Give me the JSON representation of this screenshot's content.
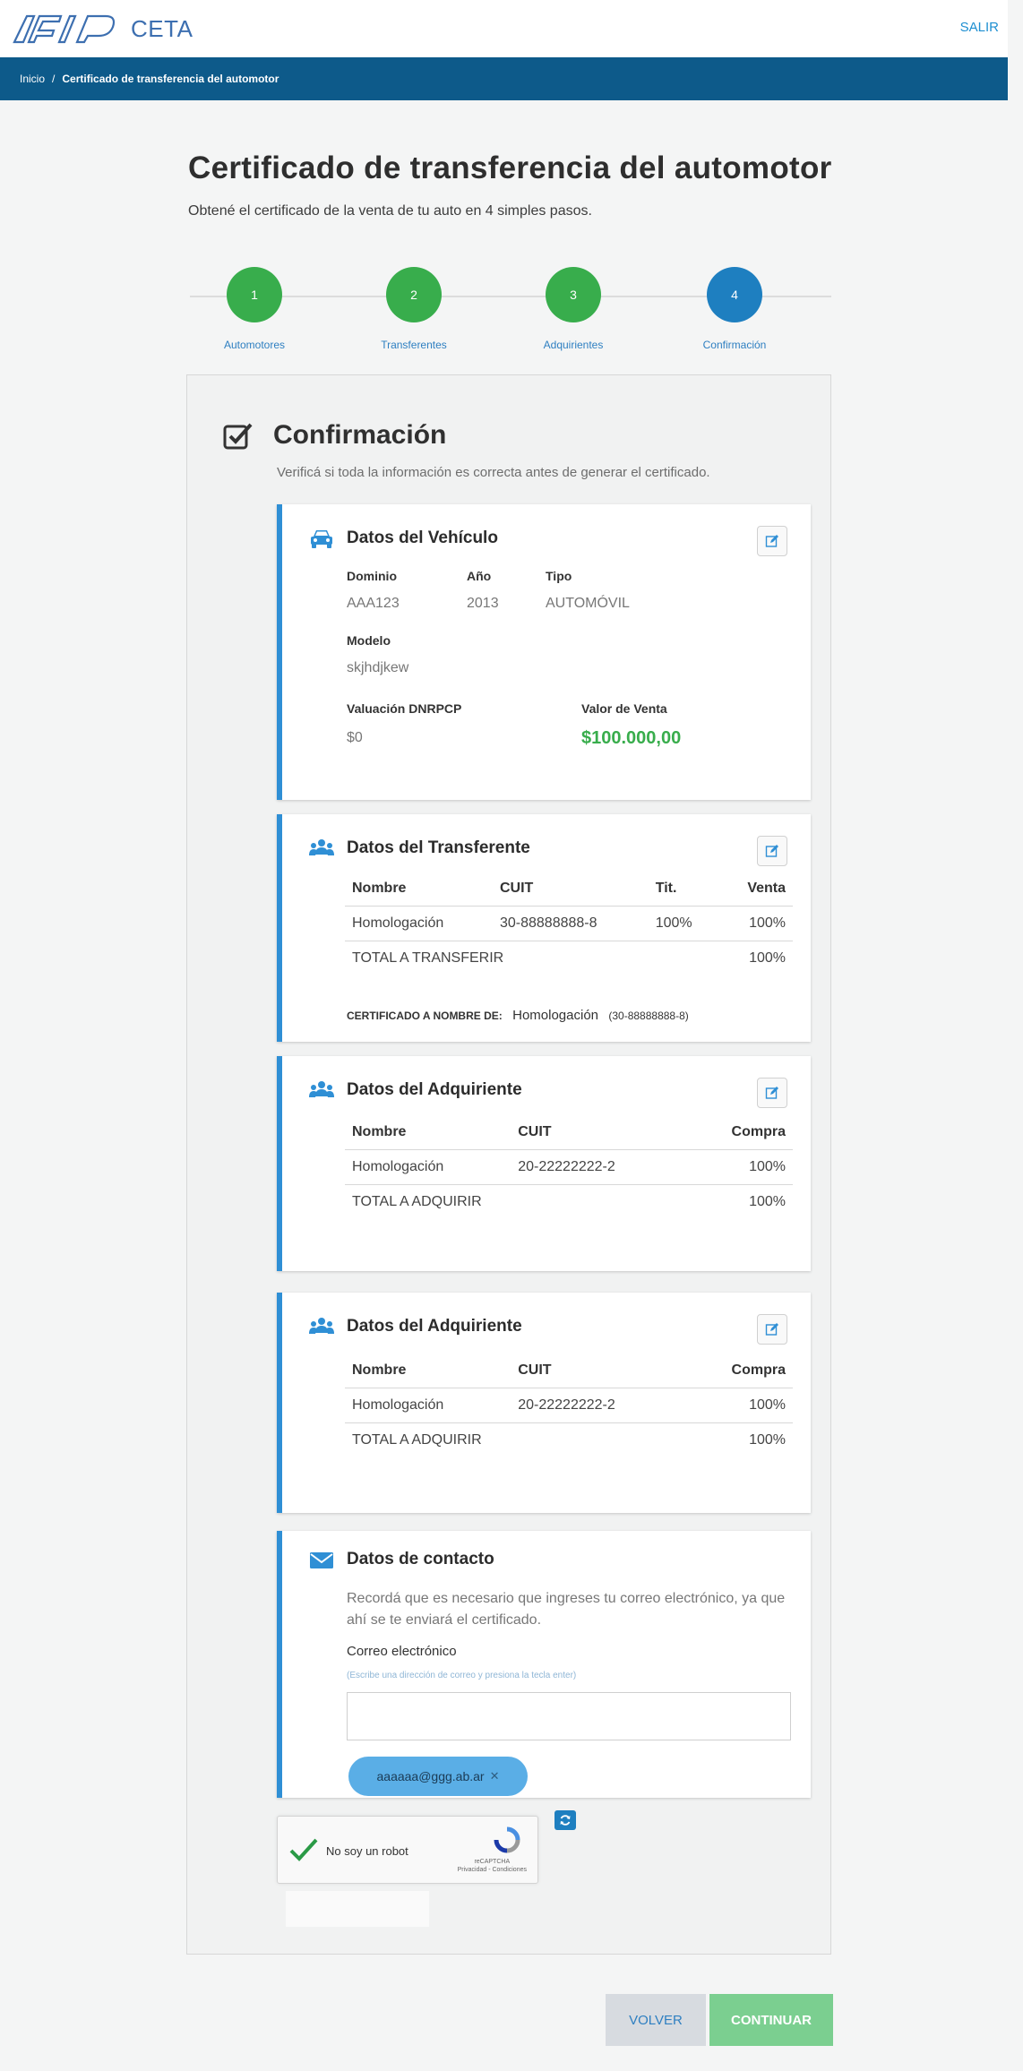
{
  "header": {
    "logo_text": "AFIP",
    "app_name": "CETA",
    "logout_label": "SALIR"
  },
  "breadcrumb": {
    "home": "Inicio",
    "separator": "/",
    "current": "Certificado de transferencia del automotor"
  },
  "page": {
    "title": "Certificado de transferencia del automotor",
    "subtitle": "Obtené el certificado de la venta de tu auto en 4 simples pasos."
  },
  "stepper": {
    "steps": [
      {
        "number": "1",
        "label": "Automotores",
        "state": "done"
      },
      {
        "number": "2",
        "label": "Transferentes",
        "state": "done"
      },
      {
        "number": "3",
        "label": "Adquirientes",
        "state": "done"
      },
      {
        "number": "4",
        "label": "Confirmación",
        "state": "active"
      }
    ],
    "colors": {
      "done": "#38ad4c",
      "active": "#1e7fc0"
    }
  },
  "confirmation": {
    "title": "Confirmación",
    "description": "Verificá si toda la información es correcta antes de generar el certificado."
  },
  "vehiculo": {
    "title": "Datos del Vehículo",
    "icon": "car-icon",
    "dominio_label": "Dominio",
    "dominio": "AAA123",
    "anio_label": "Año",
    "anio": "2013",
    "tipo_label": "Tipo",
    "tipo": "AUTOMÓVIL",
    "modelo_label": "Modelo",
    "modelo": "skjhdjkew",
    "valuacion_label": "Valuación DNRPCP",
    "valuacion": "$0",
    "valor_label": "Valor de Venta",
    "valor": "$100.000,00"
  },
  "transferente": {
    "title": "Datos del Transferente",
    "icon": "users-icon",
    "headers": {
      "nombre": "Nombre",
      "cuit": "CUIT",
      "tit": "Tit.",
      "venta": "Venta"
    },
    "row": {
      "nombre": "Homologación",
      "cuit": "30-88888888-8",
      "tit": "100%",
      "venta": "100%"
    },
    "total_label": "TOTAL A TRANSFERIR",
    "total": "100%",
    "cert_label": "CERTIFICADO A NOMBRE DE:",
    "cert_name": "Homologación",
    "cert_cuit": "(30-88888888-8)"
  },
  "adquirientes": [
    {
      "title": "Datos del Adquiriente",
      "headers": {
        "nombre": "Nombre",
        "cuit": "CUIT",
        "compra": "Compra"
      },
      "row": {
        "nombre": "Homologación",
        "cuit": "20-22222222-2",
        "compra": "100%"
      },
      "total_label": "TOTAL A ADQUIRIR",
      "total": "100%"
    },
    {
      "title": "Datos del Adquiriente",
      "headers": {
        "nombre": "Nombre",
        "cuit": "CUIT",
        "compra": "Compra"
      },
      "row": {
        "nombre": "Homologación",
        "cuit": "20-22222222-2",
        "compra": "100%"
      },
      "total_label": "TOTAL A ADQUIRIR",
      "total": "100%"
    }
  ],
  "contacto": {
    "title": "Datos de contacto",
    "icon": "envelope-icon",
    "text": "Recordá que es necesario que ingreses tu correo electrónico, ya que ahí se te enviará el certificado.",
    "email_label": "Correo electrónico",
    "email_hint": "(Escribe una dirección de correo y presiona la tecla enter)",
    "input_value": "",
    "chip": "aaaaaa@ggg.ab.ar",
    "chip_remove": "✕"
  },
  "captcha": {
    "label": "No soy un robot",
    "brand": "reCAPTCHA",
    "links": "Privacidad - Condiciones"
  },
  "buttons": {
    "volver": "VOLVER",
    "continuar": "CONTINUAR"
  }
}
